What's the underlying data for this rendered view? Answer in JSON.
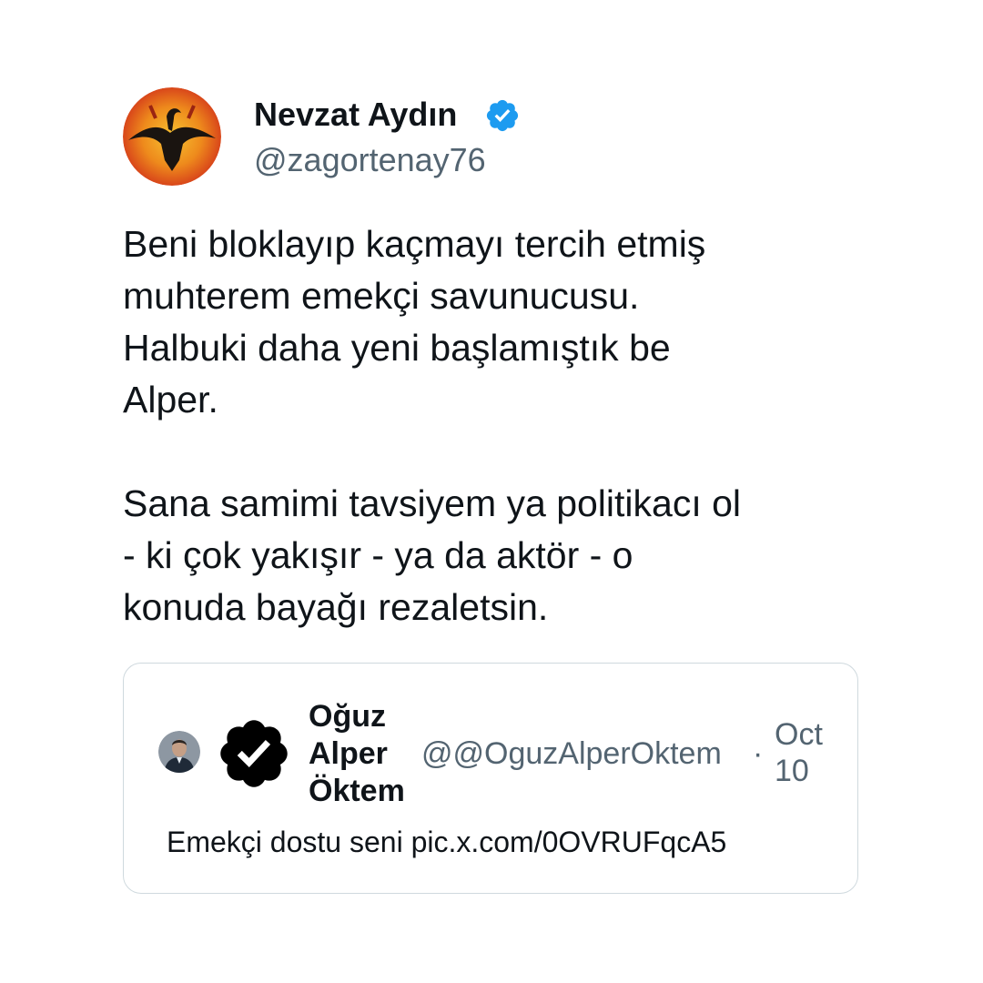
{
  "author": {
    "display_name": "Nevzat Aydın",
    "handle": "@zagortenay76",
    "verified": true,
    "avatar_icon": "phoenix-emblem-avatar",
    "badge_icon": "verified-badge-icon",
    "badge_color": "#1d9bf0"
  },
  "tweet": {
    "paragraphs": [
      "Beni bloklayıp kaçmayı tercih etmiş\nmuhterem emekçi savunucusu.\nHalbuki daha yeni başlamıştık be\nAlper.",
      "Sana samimi tavsiyem ya politikacı ol\n- ki çok yakışır - ya da aktör - o\nkonuda bayağı rezaletsin."
    ]
  },
  "quoted_tweet": {
    "display_name": "Oğuz\nAlper\nÖktem",
    "handle": "@@OguzAlperOktem",
    "separator": "·",
    "date": "Oct\n10",
    "text": "Emekçi dostu seni pic.x.com/0OVRUFqcA5",
    "avatar_icon": "profile-photo-avatar",
    "badge_icon": "verified-badge-icon",
    "badge_color": "#000000"
  },
  "colors": {
    "text_primary": "#0f1419",
    "text_secondary": "#536471",
    "border": "#cfd9de",
    "background": "#ffffff"
  }
}
